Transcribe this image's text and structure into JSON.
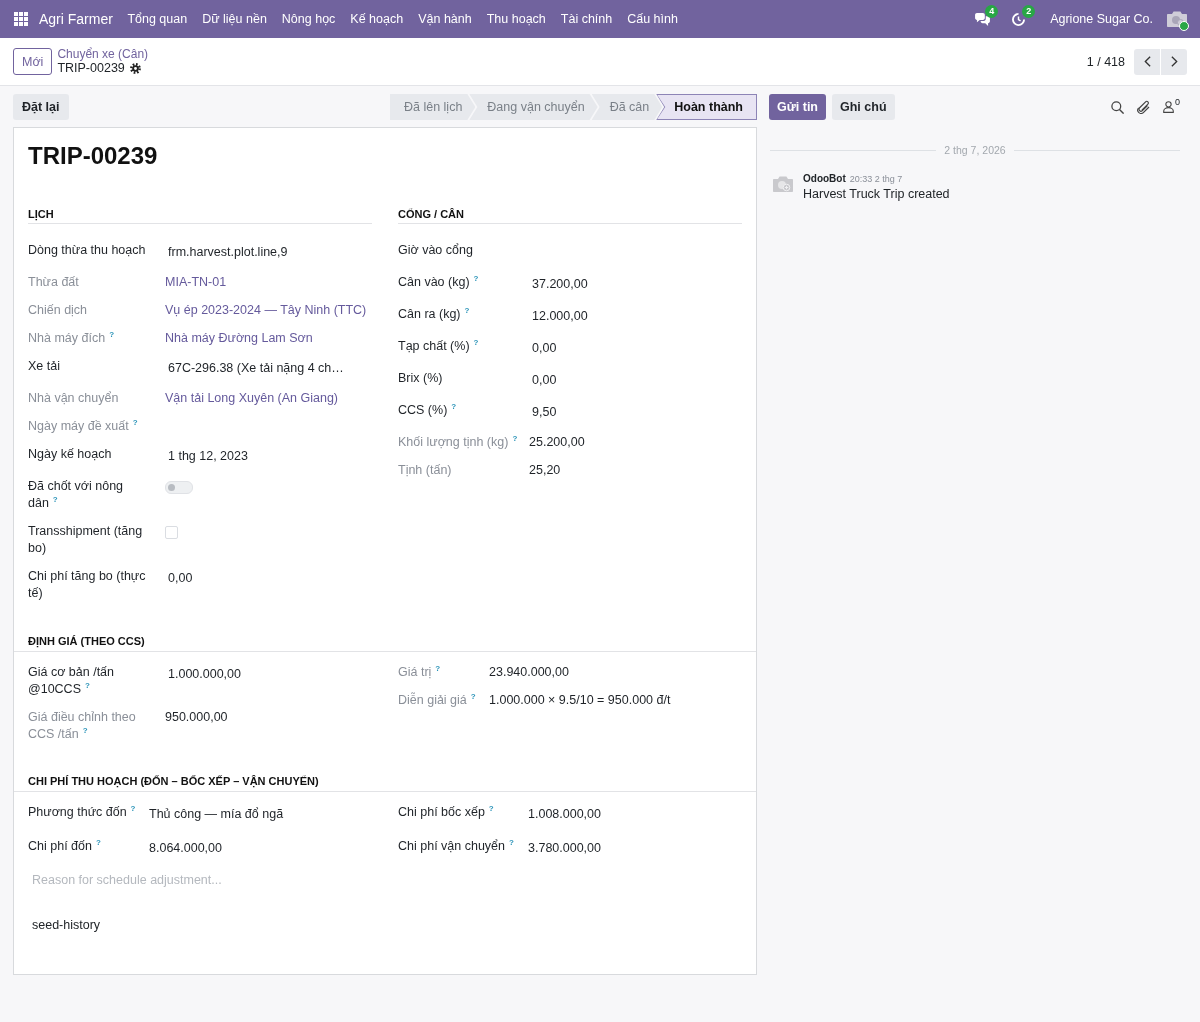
{
  "navbar": {
    "app_name": "Agri Farmer",
    "menu": [
      "Tổng quan",
      "Dữ liệu nền",
      "Nông học",
      "Kế hoạch",
      "Vận hành",
      "Thu hoạch",
      "Tài chính",
      "Cấu hình"
    ],
    "messages_badge": "4",
    "activities_badge": "2",
    "company": "Agrione Sugar Co.",
    "user_online": true
  },
  "control_panel": {
    "new_button": "Mới",
    "breadcrumb": "Chuyển xe (Cân)",
    "record_name": "TRIP-00239",
    "pager": "1 / 418"
  },
  "status_bar": {
    "reset_button": "Đặt lại",
    "stages": [
      {
        "label": "Đã lên lịch",
        "selected": false
      },
      {
        "label": "Đang vận chuyển",
        "selected": false
      },
      {
        "label": "Đã cân",
        "selected": false
      },
      {
        "label": "Hoàn thành",
        "selected": true
      }
    ]
  },
  "form": {
    "title": "TRIP-00239",
    "top_groups": [
      {
        "title": "LỊCH",
        "fields": [
          {
            "label": "Dòng thừa thu hoạch",
            "kind": "text",
            "value": "frm.harvest.plot.line,9",
            "readonly": false
          },
          {
            "label": "Thừa đất",
            "kind": "link",
            "value": "MIA-TN-01",
            "readonly": true
          },
          {
            "label": "Chiến dịch",
            "kind": "link",
            "value": "Vụ ép 2023-2024 — Tây Ninh (TTC)",
            "readonly": true
          },
          {
            "label": "Nhà máy đích$^{?}$",
            "kind": "link",
            "value": "Nhà máy Đường Lam Sơn",
            "readonly": true
          },
          {
            "label": "Xe tải",
            "kind": "text",
            "value": "67C-296.38 (Xe tải nặng 4 ch…",
            "readonly": false
          },
          {
            "label": "Nhà vận chuyển",
            "kind": "link",
            "value": "Vận tải Long Xuyên (An Giang)",
            "readonly": true
          },
          {
            "label": "Ngày máy đề xuất$^{?}$",
            "kind": "text",
            "readonly": true
          },
          {
            "label": "Ngày kế hoạch",
            "kind": "text",
            "value": "1 thg 12, 2023",
            "readonly": false
          },
          {
            "label": "Đã chốt với nông dân$^{?}$",
            "kind": "toggle",
            "on": false,
            "readonly": false
          },
          {
            "label": "Transshipment (tăng bo)",
            "kind": "checkbox",
            "checked": false,
            "readonly": false
          },
          {
            "label": "Chi phí tăng bo (thực tế)",
            "kind": "text",
            "value": "0,00",
            "readonly": false
          }
        ]
      },
      {
        "title": "CỔNG / CÂN",
        "fields": [
          {
            "label": "Giờ vào cổng",
            "kind": "text",
            "readonly": false
          },
          {
            "label": "Cân vào (kg)$^{?}$",
            "kind": "text",
            "value": "37.200,00",
            "readonly": false
          },
          {
            "label": "Cân ra (kg)$^{?}$",
            "kind": "text",
            "value": "12.000,00",
            "readonly": false
          },
          {
            "label": "Tạp chất (%)$^{?}$",
            "kind": "text",
            "value": "0,00",
            "readonly": false
          },
          {
            "label": "Brix (%)",
            "kind": "text",
            "value": "0,00",
            "readonly": false
          },
          {
            "label": "CCS (%)$^{?}$",
            "kind": "text",
            "value": "9,50",
            "readonly": false
          },
          {
            "label": "Khối lượng tịnh (kg)$^{?}$",
            "kind": "text",
            "value": "25.200,00",
            "readonly": true
          },
          {
            "label": "Tịnh (tấn)",
            "kind": "text",
            "value": "25,20",
            "readonly": true
          }
        ]
      }
    ],
    "sections": [
      {
        "title": "ĐỊNH GIÁ (THEO CCS)",
        "columns": [
          {
            "fields": [
              {
                "label": "Giá cơ bản /tấn @10CCS$^{?}$",
                "kind": "text",
                "value": "1.000.000,00",
                "readonly": false
              },
              {
                "label": "Giá điều chỉnh theo CCS /tấn$^{?}$",
                "kind": "text",
                "value": "950.000,00",
                "readonly": true
              }
            ]
          },
          {
            "fields": [
              {
                "label": "Giá trị$^{?}$",
                "kind": "text",
                "value": "23.940.000,00",
                "readonly": true
              },
              {
                "label": "Diễn giải giá$^{?}$",
                "kind": "text",
                "value": "1.000.000 × 9.5/10 = 950.000 đ/t",
                "readonly": true
              }
            ]
          }
        ]
      },
      {
        "title": "CHI PHÍ THU HOẠCH (ĐỐN – BỐC XẾP – VẬN CHUYỂN)",
        "columns": [
          {
            "fields": [
              {
                "label": "Phương thức đốn$^{?}$",
                "kind": "text",
                "value": "Thủ công — mía đổ ngã",
                "readonly": false
              },
              {
                "label": "Chi phí đốn$^{?}$",
                "kind": "text",
                "value": "8.064.000,00",
                "readonly": false
              }
            ]
          },
          {
            "fields": [
              {
                "label": "Chi phí bốc xếp$^{?}$",
                "kind": "text",
                "value": "1.008.000,00",
                "readonly": false
              },
              {
                "label": "Chi phí vận chuyển$^{?}$",
                "kind": "text",
                "value": "3.780.000,00",
                "readonly": false
              }
            ]
          }
        ]
      }
    ],
    "notes": {
      "placeholder": "Reason for schedule adjustment..."
    },
    "history": "seed-history"
  },
  "chatter": {
    "buttons": [
      {
        "label": "Gửi tin",
        "selected": true
      },
      {
        "label": "Ghi chú",
        "selected": false
      }
    ],
    "followers_count": "0",
    "date_separator": "2 thg 7, 2026",
    "messages": [
      {
        "author": "OdooBot",
        "time": "20:33 2 thg 7",
        "body": "Harvest Truck Trip created"
      }
    ]
  }
}
